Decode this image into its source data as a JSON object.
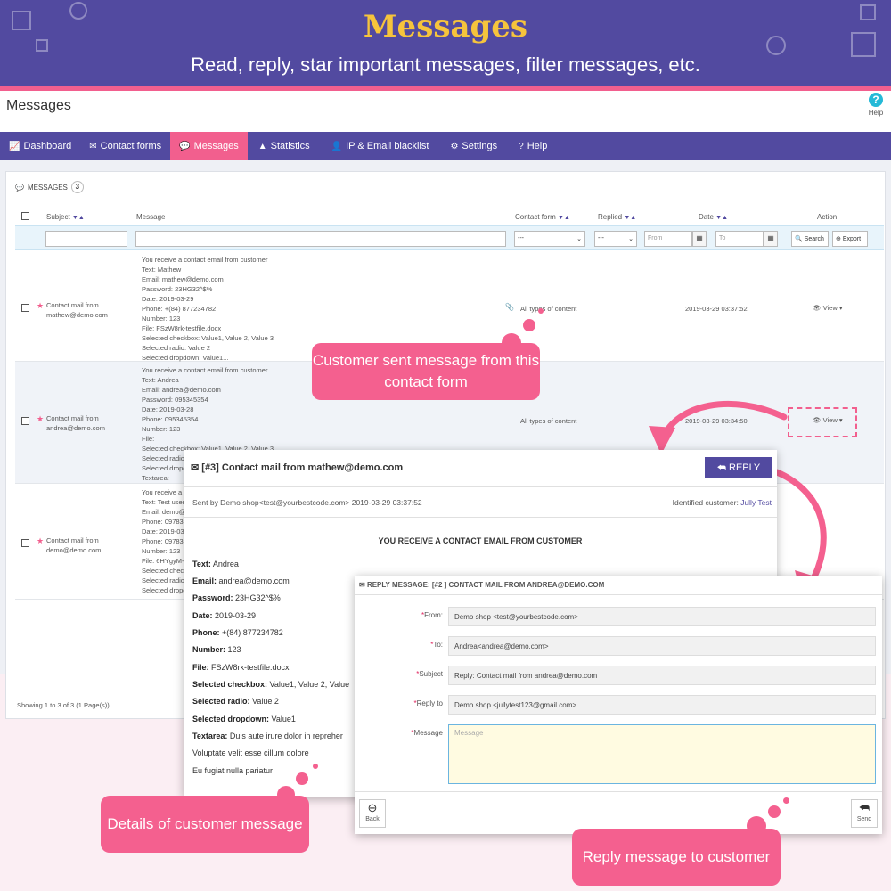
{
  "banner": {
    "title": "Messages",
    "subtitle": "Read, reply, star important messages, filter messages, etc."
  },
  "admin": {
    "page_title": "Messages",
    "help_label": "Help",
    "tabs": [
      {
        "label": "Dashboard",
        "icon": "chart-line-icon",
        "glyph": "📈"
      },
      {
        "label": "Contact forms",
        "icon": "envelope-icon",
        "glyph": "✉"
      },
      {
        "label": "Messages",
        "icon": "comments-icon",
        "glyph": "💬",
        "active": true
      },
      {
        "label": "Statistics",
        "icon": "area-chart-icon",
        "glyph": "▲"
      },
      {
        "label": "IP & Email blacklist",
        "icon": "user-block-icon",
        "glyph": "👤"
      },
      {
        "label": "Settings",
        "icon": "gear-icon",
        "glyph": "⚙"
      },
      {
        "label": "Help",
        "icon": "question-icon",
        "glyph": "?"
      }
    ],
    "panel": {
      "title": "MESSAGES",
      "count": "3",
      "columns": {
        "subject": "Subject",
        "message": "Message",
        "contact_form": "Contact form",
        "replied": "Replied",
        "date": "Date",
        "action": "Action"
      },
      "filters": {
        "contact_form_value": "---",
        "replied_value": "---",
        "from_placeholder": "From",
        "to_placeholder": "To",
        "search_label": "Search",
        "export_label": "Export"
      },
      "rows": [
        {
          "subject": [
            "Contact mail from",
            "mathew@demo.com"
          ],
          "message": [
            "You receive a contact email from customer",
            "Text: Mathew",
            "Email: mathew@demo.com",
            "Password: 23HG32^$%",
            "Date: 2019-03-29",
            "Phone: +(84) 877234782",
            "Number: 123",
            "File: FSzW8rk-testfile.docx",
            "Selected checkbox: Value1, Value 2, Value 3",
            "Selected radio: Value 2",
            "Selected dropdown: Value1..."
          ],
          "contact_form": "All types of content",
          "date": "2019-03-29 03:37:52",
          "action": "View"
        },
        {
          "subject": [
            "Contact mail from",
            "andrea@demo.com"
          ],
          "message": [
            "You receive a contact email from customer",
            "Text: Andrea",
            "Email: andrea@demo.com",
            "Password: 095345354",
            "Date: 2019-03-28",
            "Phone: 095345354",
            "Number: 123",
            "File:",
            "Selected checkbox: Value1, Value 2, Value 3",
            "Selected radio:",
            "Selected dropd",
            "Textarea:"
          ],
          "contact_form": "All types of content",
          "date": "2019-03-29 03:34:50",
          "action": "View"
        },
        {
          "subject": [
            "Contact mail from",
            "demo@demo.com"
          ],
          "message": [
            "You receive a c",
            "Text: Test user",
            "Email: demo@d",
            "Phone: 09783",
            "Date: 2019-03-2",
            "Phone: 097835",
            "Number: 123",
            "File: 6HYgyM-",
            "Selected checkb",
            "Selected radio:",
            "Selected dropd"
          ],
          "contact_form": "",
          "date": "",
          "action": "View"
        }
      ],
      "showing": "Showing 1 to 3 of 3 (1 Page(s))"
    }
  },
  "callouts": {
    "contact_form": "Customer sent message from this contact form",
    "details": "Details of customer message",
    "reply": "Reply message to customer"
  },
  "detail": {
    "title": "[#3] Contact mail from mathew@demo.com",
    "reply_label": "REPLY",
    "sent_by": "Sent by Demo shop<test@yourbestcode.com>  2019-03-29 03:37:52",
    "identified_label": "Identified customer:",
    "identified_name": "Jully Test",
    "heading": "YOU RECEIVE A CONTACT EMAIL FROM CUSTOMER",
    "fields": [
      {
        "label": "Text:",
        "value": " Andrea"
      },
      {
        "label": "Email:",
        "value": " andrea@demo.com"
      },
      {
        "label": "Password:",
        "value": " 23HG32^$%"
      },
      {
        "label": "Date:",
        "value": " 2019-03-29"
      },
      {
        "label": "Phone:",
        "value": " +(84) 877234782"
      },
      {
        "label": "Number:",
        "value": " 123"
      },
      {
        "label": "File:",
        "value": " FSzW8rk-testfile.docx"
      },
      {
        "label": "Selected checkbox:",
        "value": " Value1, Value 2, Value"
      },
      {
        "label": "Selected radio:",
        "value": " Value 2"
      },
      {
        "label": "Selected dropdown:",
        "value": " Value1"
      },
      {
        "label": "Textarea:",
        "value": " Duis aute irure dolor in repreher"
      }
    ],
    "extra_lines": [
      "Voluptate velit esse cillum dolore",
      "Eu fugiat nulla pariatur"
    ]
  },
  "reply_form": {
    "title": "REPLY MESSAGE: [#2 ] CONTACT MAIL FROM ANDREA@DEMO.COM",
    "from_label": "From:",
    "from_value": "Demo shop <test@yourbestcode.com>",
    "to_label": "To:",
    "to_value": "Andrea<andrea@demo.com>",
    "subject_label": "Subject",
    "subject_value": "Reply: Contact mail from andrea@demo.com",
    "replyto_label": "Reply to",
    "replyto_value": "Demo shop <jullytest123@gmail.com>",
    "message_label": "Message",
    "message_placeholder": "Message",
    "back_label": "Back",
    "send_label": "Send"
  },
  "colors": {
    "primary": "#524aa0",
    "accent": "#f25f8e",
    "title_gold": "#f6c43c"
  }
}
